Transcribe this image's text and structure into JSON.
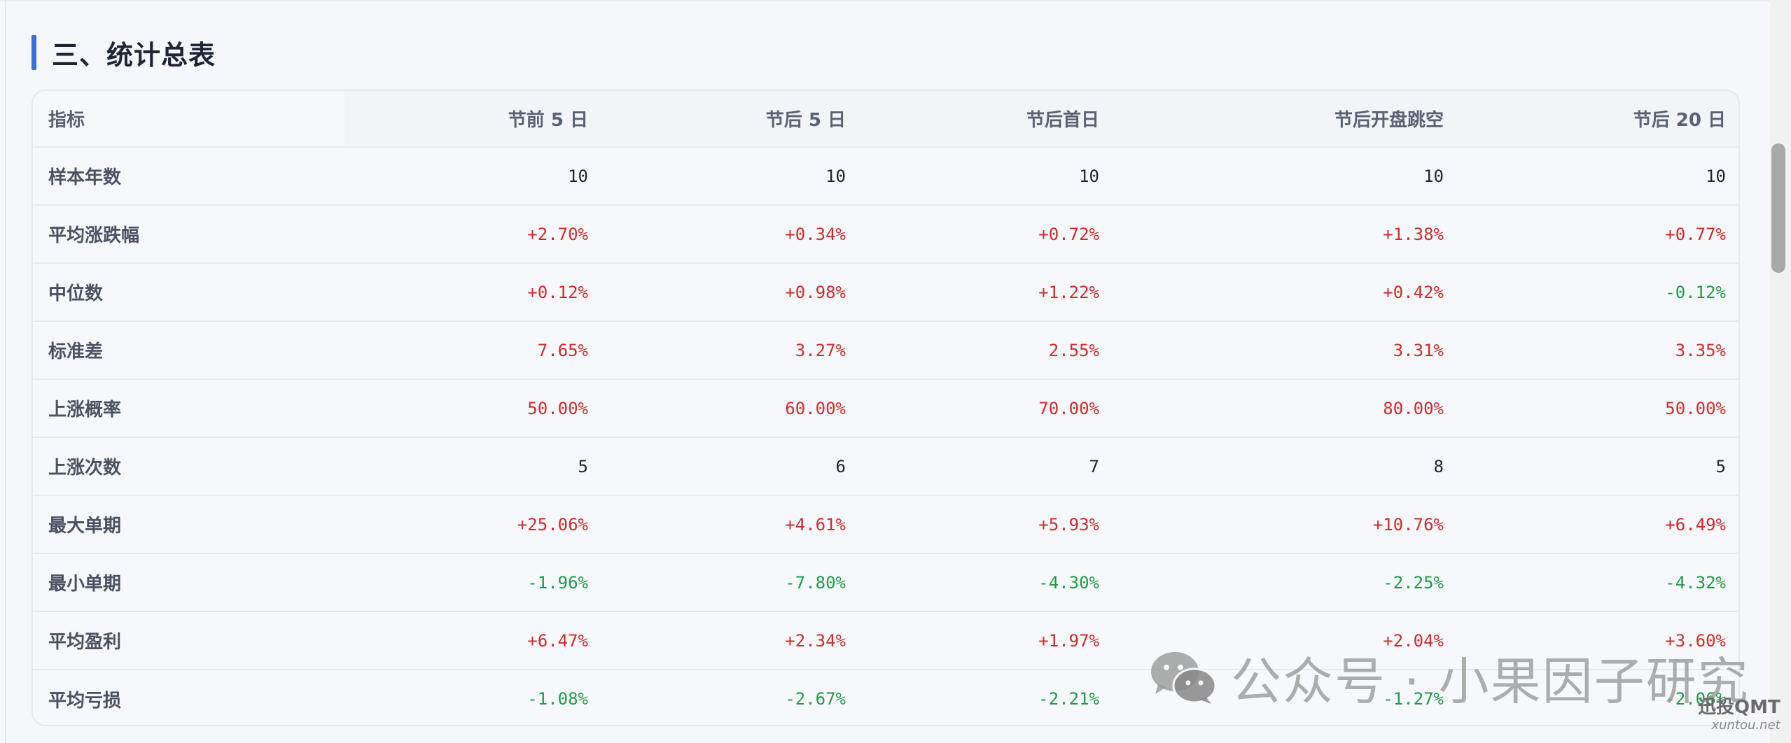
{
  "section": {
    "title": "三、统计总表"
  },
  "table": {
    "headers": [
      "指标",
      "节前 5 日",
      "节后 5 日",
      "节后首日",
      "节后开盘跳空",
      "节后 20 日"
    ],
    "rows": [
      {
        "label": "样本年数",
        "values": [
          "10",
          "10",
          "10",
          "10",
          "10"
        ],
        "tones": [
          "neu",
          "neu",
          "neu",
          "neu",
          "neu"
        ]
      },
      {
        "label": "平均涨跌幅",
        "values": [
          "+2.70%",
          "+0.34%",
          "+0.72%",
          "+1.38%",
          "+0.77%"
        ],
        "tones": [
          "pos",
          "pos",
          "pos",
          "pos",
          "pos"
        ]
      },
      {
        "label": "中位数",
        "values": [
          "+0.12%",
          "+0.98%",
          "+1.22%",
          "+0.42%",
          "-0.12%"
        ],
        "tones": [
          "pos",
          "pos",
          "pos",
          "pos",
          "neg"
        ]
      },
      {
        "label": "标准差",
        "values": [
          "7.65%",
          "3.27%",
          "2.55%",
          "3.31%",
          "3.35%"
        ],
        "tones": [
          "pos",
          "pos",
          "pos",
          "pos",
          "pos"
        ]
      },
      {
        "label": "上涨概率",
        "values": [
          "50.00%",
          "60.00%",
          "70.00%",
          "80.00%",
          "50.00%"
        ],
        "tones": [
          "pos",
          "pos",
          "pos",
          "pos",
          "pos"
        ]
      },
      {
        "label": "上涨次数",
        "values": [
          "5",
          "6",
          "7",
          "8",
          "5"
        ],
        "tones": [
          "neu",
          "neu",
          "neu",
          "neu",
          "neu"
        ]
      },
      {
        "label": "最大单期",
        "values": [
          "+25.06%",
          "+4.61%",
          "+5.93%",
          "+10.76%",
          "+6.49%"
        ],
        "tones": [
          "pos",
          "pos",
          "pos",
          "pos",
          "pos"
        ]
      },
      {
        "label": "最小单期",
        "values": [
          "-1.96%",
          "-7.80%",
          "-4.30%",
          "-2.25%",
          "-4.32%"
        ],
        "tones": [
          "neg",
          "neg",
          "neg",
          "neg",
          "neg"
        ]
      },
      {
        "label": "平均盈利",
        "values": [
          "+6.47%",
          "+2.34%",
          "+1.97%",
          "+2.04%",
          "+3.60%"
        ],
        "tones": [
          "pos",
          "pos",
          "pos",
          "pos",
          "pos"
        ]
      },
      {
        "label": "平均亏损",
        "values": [
          "-1.08%",
          "-2.67%",
          "-2.21%",
          "-1.27%",
          "-2.06%"
        ],
        "tones": [
          "neg",
          "neg",
          "neg",
          "neg",
          "neg"
        ]
      }
    ]
  },
  "watermark": {
    "icon": "wechat-icon",
    "text": "公众号 · 小果因子研究"
  },
  "brand": {
    "main": "迅投QMT",
    "sub": "xuntou.net"
  },
  "colors": {
    "accent": "#3b6fd6",
    "positive": "#cc2b2b",
    "negative": "#1f9a4a",
    "neutral": "#1e2433"
  }
}
